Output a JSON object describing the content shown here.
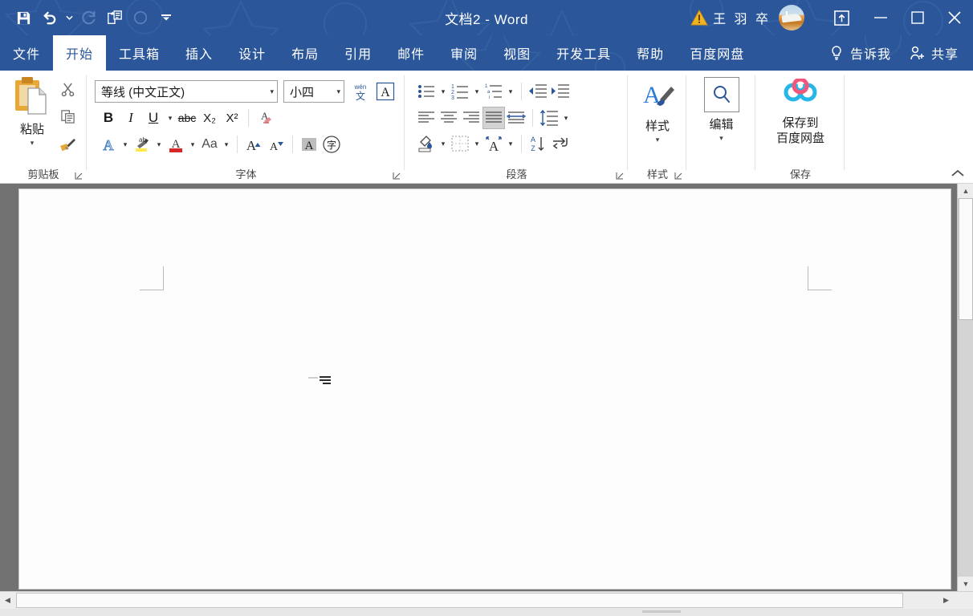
{
  "window": {
    "title": "文档2  -  Word",
    "user_name": "王 羽 卒",
    "accent_color": "#2b579a",
    "quick_access": [
      {
        "name": "save-icon",
        "label": "保存"
      },
      {
        "name": "undo-icon",
        "label": "撤消"
      },
      {
        "name": "undo-dropdown-icon",
        "label": "撤消下拉"
      },
      {
        "name": "redo-icon",
        "label": "恢复"
      },
      {
        "name": "quick-print-icon",
        "label": "快速打印"
      },
      {
        "name": "circle-icon",
        "label": "圆形"
      },
      {
        "name": "customize-qat-icon",
        "label": "自定义快速访问工具栏"
      }
    ],
    "controls": [
      {
        "name": "warning-icon",
        "label": "警告"
      },
      {
        "name": "avatar",
        "label": "用户头像"
      },
      {
        "name": "ribbon-display-options-icon",
        "label": "功能区显示选项"
      },
      {
        "name": "minimize-button",
        "label": "最小化"
      },
      {
        "name": "maximize-button",
        "label": "最大化"
      },
      {
        "name": "close-button",
        "label": "关闭"
      }
    ]
  },
  "tabs": [
    {
      "label": "文件",
      "active": false
    },
    {
      "label": "开始",
      "active": true
    },
    {
      "label": "工具箱",
      "active": false
    },
    {
      "label": "插入",
      "active": false
    },
    {
      "label": "设计",
      "active": false
    },
    {
      "label": "布局",
      "active": false
    },
    {
      "label": "引用",
      "active": false
    },
    {
      "label": "邮件",
      "active": false
    },
    {
      "label": "审阅",
      "active": false
    },
    {
      "label": "视图",
      "active": false
    },
    {
      "label": "开发工具",
      "active": false
    },
    {
      "label": "帮助",
      "active": false
    },
    {
      "label": "百度网盘",
      "active": false
    }
  ],
  "tabbar_right": {
    "tell_me": "告诉我",
    "share": "共享"
  },
  "ribbon": {
    "clipboard": {
      "group_label": "剪贴板",
      "paste_label": "粘贴",
      "cut_label": "剪切",
      "copy_label": "复制",
      "format_painter_label": "格式刷"
    },
    "font": {
      "group_label": "字体",
      "font_name": "等线 (中文正文)",
      "font_size": "小四",
      "phonetic_guide_label": "拼音指南",
      "char_border_label": "字符边框",
      "bold": "B",
      "italic": "I",
      "underline": "U",
      "strikethrough": "abc",
      "subscript": "X₂",
      "superscript": "X²",
      "clear_formatting_label": "清除所有格式",
      "text_effects_label": "文本效果和版式",
      "highlight_label": "以不同颜色突出显示文本",
      "font_color_label": "字体颜色",
      "change_case": "Aa",
      "grow_font": "A",
      "shrink_font": "A",
      "char_shading_label": "字符底纹",
      "enclose_char": "字"
    },
    "paragraph": {
      "group_label": "段落",
      "bullets_label": "项目符号",
      "numbering_label": "编号",
      "multilevel_label": "多级列表",
      "decrease_indent_label": "减少缩进量",
      "increase_indent_label": "增加缩进量",
      "align_left_label": "左对齐",
      "align_center_label": "居中",
      "align_right_label": "右对齐",
      "justify_label": "两端对齐",
      "distribute_label": "分散对齐",
      "line_spacing_label": "行和段落间距",
      "shading_label": "底纹",
      "borders_label": "边框",
      "asian_layout_label": "中文版式",
      "sort_label": "排序",
      "show_marks_label": "显示/隐藏编辑标记"
    },
    "styles": {
      "group_label": "样式",
      "button_label": "样式"
    },
    "editing": {
      "group_label": "",
      "button_label": "编辑"
    },
    "baidu": {
      "group_label": "保存",
      "button_line1": "保存到",
      "button_line2": "百度网盘"
    },
    "collapse_label": "折叠功能区"
  },
  "document": {
    "page_background": "#fdfdfd",
    "workspace_background": "#727272",
    "body_text": ""
  },
  "scrollbars": {
    "vertical_up": "▲",
    "vertical_down": "▼",
    "horizontal_left": "◀",
    "horizontal_right": "▶"
  }
}
